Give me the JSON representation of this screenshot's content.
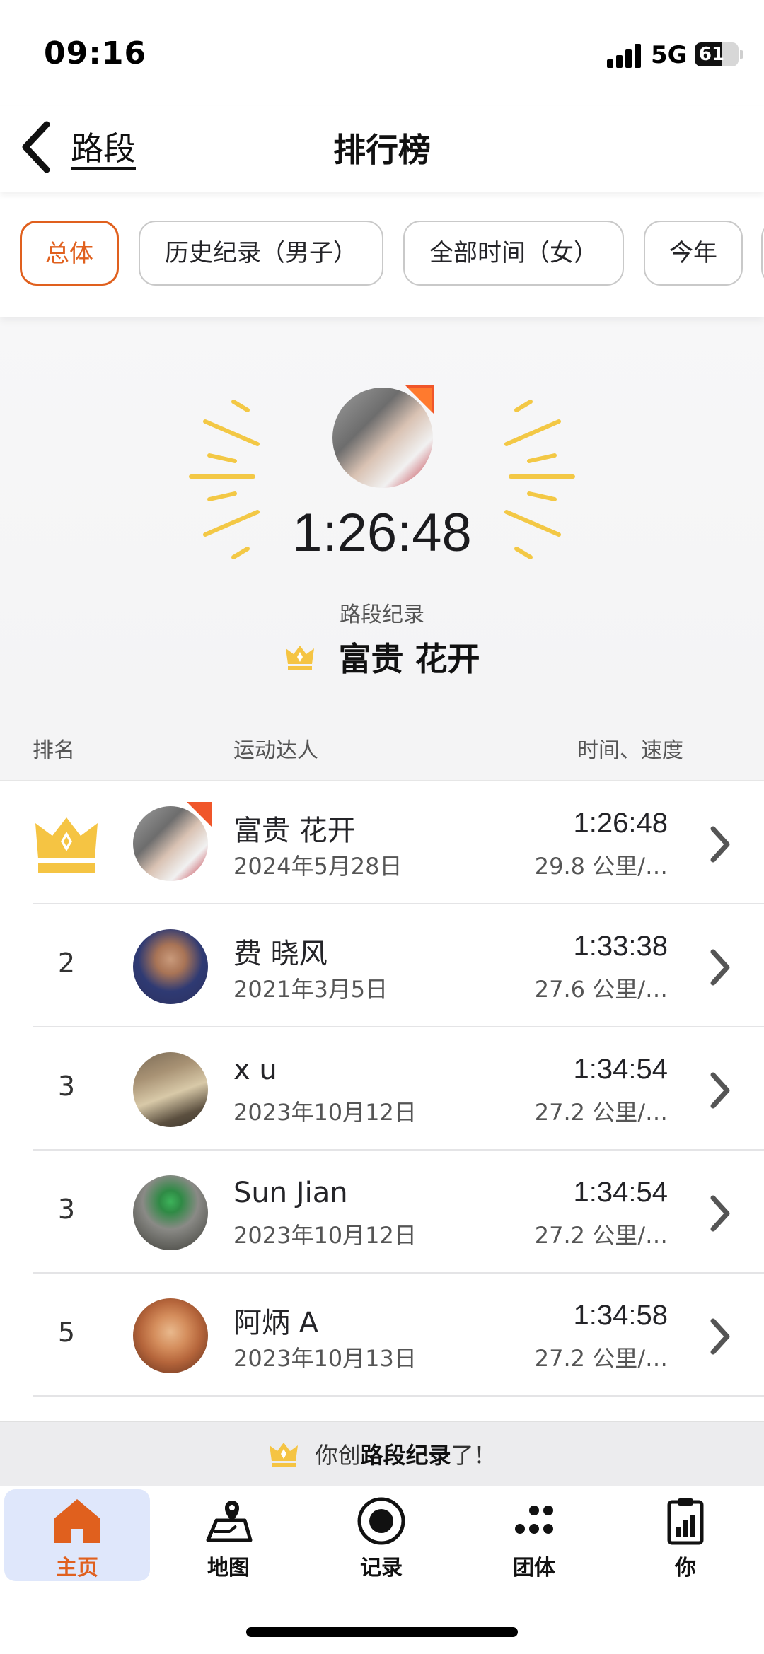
{
  "status_bar": {
    "time": "09:16",
    "network": "5G",
    "battery": "61",
    "battery_fraction": 0.61
  },
  "header": {
    "back_label": "路段",
    "title": "排行榜"
  },
  "filters": [
    {
      "label": "总体",
      "active": true
    },
    {
      "label": "历史纪录（男子）",
      "active": false
    },
    {
      "label": "全部时间（女）",
      "active": false
    },
    {
      "label": "今年",
      "active": false
    }
  ],
  "record": {
    "time": "1:26:48",
    "label": "路段纪录",
    "holder": "富贵 花开"
  },
  "table_header": {
    "rank": "排名",
    "athlete": "运动达人",
    "time_speed": "时间、速度"
  },
  "rows": [
    {
      "rank": "1",
      "crown": true,
      "name": "富贵 花开",
      "date": "2024年5月28日",
      "time": "1:26:48",
      "speed": "29.8 公里/…"
    },
    {
      "rank": "2",
      "crown": false,
      "name": "费 晓风",
      "date": "2021年3月5日",
      "time": "1:33:38",
      "speed": "27.6 公里/…"
    },
    {
      "rank": "3",
      "crown": false,
      "name": "x u",
      "date": "2023年10月12日",
      "time": "1:34:54",
      "speed": "27.2 公里/…"
    },
    {
      "rank": "3",
      "crown": false,
      "name": "Sun Jian",
      "date": "2023年10月12日",
      "time": "1:34:54",
      "speed": "27.2 公里/…"
    },
    {
      "rank": "5",
      "crown": false,
      "name": "阿炳 A",
      "date": "2023年10月13日",
      "time": "1:34:58",
      "speed": "27.2 公里/…"
    }
  ],
  "banner": {
    "prefix": "你创",
    "bold": "路段纪录",
    "suffix": "了！"
  },
  "bottom_nav": [
    {
      "label": "主页",
      "icon": "home-icon",
      "active": true
    },
    {
      "label": "地图",
      "icon": "map-icon",
      "active": false
    },
    {
      "label": "记录",
      "icon": "record-icon",
      "active": false
    },
    {
      "label": "团体",
      "icon": "groups-icon",
      "active": false
    },
    {
      "label": "你",
      "icon": "profile-icon",
      "active": false
    }
  ],
  "colors": {
    "accent": "#e0601e",
    "crown": "#f5c443",
    "badge": "#f0562a",
    "active_tab_bg": "#dfe7fb"
  }
}
